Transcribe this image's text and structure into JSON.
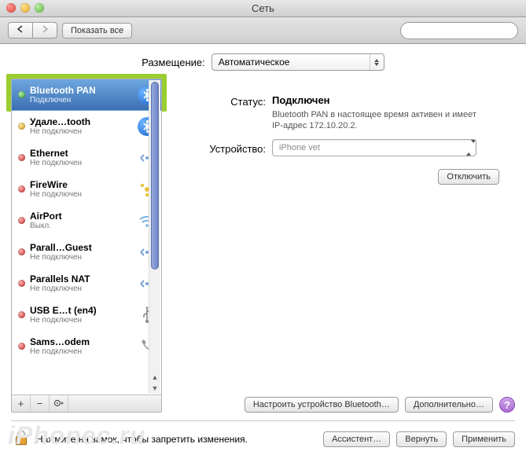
{
  "window": {
    "title": "Сеть"
  },
  "toolbar": {
    "show_all": "Показать все",
    "search_placeholder": ""
  },
  "location": {
    "label": "Размещение:",
    "value": "Автоматическое"
  },
  "sidebar": {
    "items": [
      {
        "name": "Bluetooth PAN",
        "status_label": "Подключен",
        "status": "green",
        "icon": "bluetooth",
        "selected": true
      },
      {
        "name": "Удале…tooth",
        "status_label": "Не подключен",
        "status": "yellow",
        "icon": "bluetooth"
      },
      {
        "name": "Ethernet",
        "status_label": "Не подключен",
        "status": "red",
        "icon": "ethernet"
      },
      {
        "name": "FireWire",
        "status_label": "Не подключен",
        "status": "red",
        "icon": "firewire"
      },
      {
        "name": "AirPort",
        "status_label": "Выкл.",
        "status": "red",
        "icon": "wifi"
      },
      {
        "name": "Parall…Guest",
        "status_label": "Не подключен",
        "status": "red",
        "icon": "ethernet"
      },
      {
        "name": "Parallels NAT",
        "status_label": "Не подключен",
        "status": "red",
        "icon": "ethernet"
      },
      {
        "name": "USB E…t (en4)",
        "status_label": "Не подключен",
        "status": "red",
        "icon": "usb"
      },
      {
        "name": "Sams…odem",
        "status_label": "Не подключен",
        "status": "red",
        "icon": "modem"
      }
    ]
  },
  "detail": {
    "status_label": "Статус:",
    "status_value": "Подключен",
    "status_desc": "Bluetooth PAN в настоящее время активен и имеет IP-адрес 172.10.20.2.",
    "device_label": "Устройство:",
    "device_value": "iPhone vet",
    "disconnect": "Отключить",
    "configure_bt": "Настроить устройство Bluetooth…",
    "advanced": "Дополнительно…"
  },
  "footer": {
    "lock_text": "Нажмите на замок, чтобы запретить изменения.",
    "assistant": "Ассистент…",
    "revert": "Вернуть",
    "apply": "Применить"
  },
  "watermark": "iPhonec.ru"
}
